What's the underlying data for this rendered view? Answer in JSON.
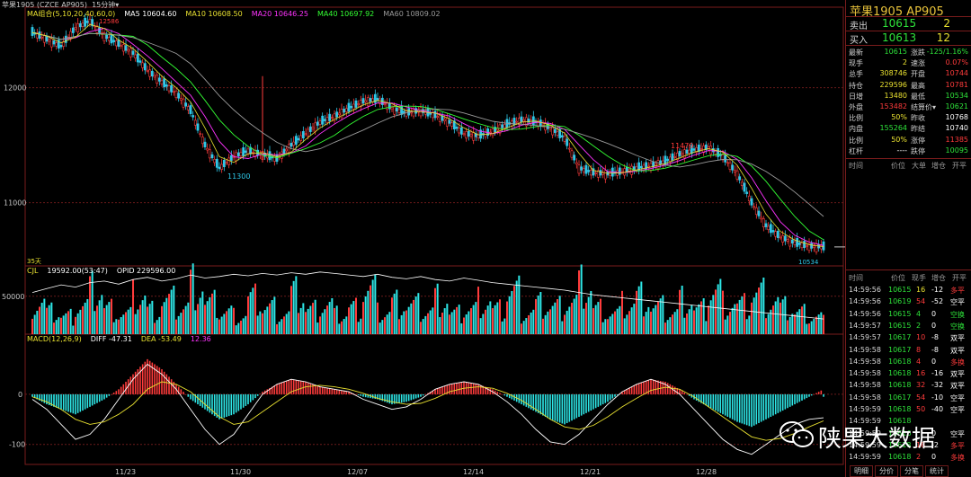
{
  "header": {
    "title": "苹果1905 (CZCE AP905)",
    "period": "15分钟",
    "ma_legend": [
      {
        "label": "MA组合(5,10,20,40,60,0)",
        "color": "#e8e030"
      },
      {
        "label": "MA5 10604.60",
        "color": "#ffffff"
      },
      {
        "label": "MA10 10608.50",
        "color": "#e8e030"
      },
      {
        "label": "MA20 10646.25",
        "color": "#ff33ff"
      },
      {
        "label": "MA40 10697.92",
        "color": "#33ff33"
      },
      {
        "label": "MA60 10809.02",
        "color": "#9a9a9a"
      }
    ],
    "vol_legend": [
      {
        "label": "CJL",
        "color": "#e8e030"
      },
      {
        "label": "19592.00(53:47)",
        "color": "#ffffff"
      },
      {
        "label": "OPID 229596.00",
        "color": "#ffffff"
      }
    ],
    "macd_legend": [
      {
        "label": "MACD(12,26,9)",
        "color": "#e8e030"
      },
      {
        "label": "DIFF -47.31",
        "color": "#ffffff"
      },
      {
        "label": "DEA -53.49",
        "color": "#e8e030"
      },
      {
        "label": "12.36",
        "color": "#ff33ff"
      }
    ]
  },
  "price_axis": {
    "labels": [
      "12000",
      "11000"
    ]
  },
  "vol_axis": {
    "labels": [
      "50000"
    ]
  },
  "macd_axis": {
    "labels": [
      "0",
      "-100"
    ]
  },
  "annotations": {
    "high_left": "12586",
    "low_mid": "11300",
    "high_right": "11479",
    "low_end": "10534",
    "bars_count": "35天"
  },
  "date_axis": [
    "11/23",
    "11/30",
    "12/07",
    "12/14",
    "12/21",
    "12/28"
  ],
  "panel": {
    "title": "苹果1905  AP905",
    "sell": {
      "label": "卖出",
      "price": "10615",
      "qty": "2"
    },
    "buy": {
      "label": "买入",
      "price": "10613",
      "qty": "12"
    },
    "stats": [
      {
        "k1": "最新",
        "v1": "10615",
        "c1": "green",
        "k2": "涨跌",
        "v2": "-125/1.16%",
        "c2": "green"
      },
      {
        "k1": "现手",
        "v1": "2",
        "c1": "yellow",
        "k2": "速涨",
        "v2": "0.07%",
        "c2": "red"
      },
      {
        "k1": "总手",
        "v1": "308746",
        "c1": "yellow",
        "k2": "开盘",
        "v2": "10744",
        "c2": "red"
      },
      {
        "k1": "持仓",
        "v1": "229596",
        "c1": "yellow",
        "k2": "最高",
        "v2": "10781",
        "c2": "red"
      },
      {
        "k1": "日增",
        "v1": "13480",
        "c1": "yellow",
        "k2": "最低",
        "v2": "10534",
        "c2": "green"
      },
      {
        "k1": "外盘",
        "v1": "153482",
        "c1": "red",
        "k2": "结算价▾",
        "v2": "10621",
        "c2": "green"
      },
      {
        "k1": "比例",
        "v1": "50%",
        "c1": "yellow",
        "k2": "昨收",
        "v2": "10768",
        "c2": "white"
      },
      {
        "k1": "内盘",
        "v1": "155264",
        "c1": "green",
        "k2": "昨结",
        "v2": "10740",
        "c2": "white"
      },
      {
        "k1": "比例",
        "v1": "50%",
        "c1": "yellow",
        "k2": "涨停",
        "v2": "11385",
        "c2": "red"
      },
      {
        "k1": "杠杆",
        "v1": "----",
        "c1": "white",
        "k2": "跌停",
        "v2": "10095",
        "c2": "green"
      }
    ],
    "trades_header_1": [
      "时间",
      "价位",
      "大单",
      "增仓",
      "开平"
    ],
    "trades_header_2": [
      "时间",
      "价位",
      "现手",
      "增仓",
      "开平"
    ],
    "trades": [
      {
        "t": "14:59:56",
        "p": "10615",
        "v": "16",
        "d": "-12",
        "o": "多平",
        "vc": "yellow",
        "oc": "red"
      },
      {
        "t": "14:59:56",
        "p": "10619",
        "v": "54",
        "d": "-52",
        "o": "空平",
        "vc": "red",
        "oc": "white"
      },
      {
        "t": "14:59:56",
        "p": "10615",
        "v": "4",
        "d": "0",
        "o": "空换",
        "vc": "green",
        "oc": "green"
      },
      {
        "t": "14:59:57",
        "p": "10615",
        "v": "2",
        "d": "0",
        "o": "空换",
        "vc": "green",
        "oc": "green"
      },
      {
        "t": "14:59:57",
        "p": "10617",
        "v": "10",
        "d": "-8",
        "o": "双平",
        "vc": "red",
        "oc": "white"
      },
      {
        "t": "14:59:58",
        "p": "10617",
        "v": "8",
        "d": "-8",
        "o": "双平",
        "vc": "red",
        "oc": "white"
      },
      {
        "t": "14:59:58",
        "p": "10618",
        "v": "4",
        "d": "0",
        "o": "多换",
        "vc": "red",
        "oc": "red"
      },
      {
        "t": "14:59:58",
        "p": "10618",
        "v": "16",
        "d": "-16",
        "o": "双平",
        "vc": "red",
        "oc": "white"
      },
      {
        "t": "14:59:58",
        "p": "10618",
        "v": "32",
        "d": "-32",
        "o": "双平",
        "vc": "red",
        "oc": "white"
      },
      {
        "t": "14:59:58",
        "p": "10617",
        "v": "54",
        "d": "-10",
        "o": "空平",
        "vc": "red",
        "oc": "white"
      },
      {
        "t": "14:59:59",
        "p": "10618",
        "v": "50",
        "d": "-40",
        "o": "空平",
        "vc": "red",
        "oc": "white"
      },
      {
        "t": "14:59:59",
        "p": "10618",
        "v": "",
        "d": "",
        "o": "",
        "vc": "red",
        "oc": "white"
      },
      {
        "t": "14:59:59",
        "p": "10616",
        "v": "",
        "d": "0",
        "o": "空平",
        "vc": "red",
        "oc": "white"
      },
      {
        "t": "14:59:59",
        "p": "10618",
        "v": "18",
        "d": "-2",
        "o": "多平",
        "vc": "red",
        "oc": "red"
      },
      {
        "t": "14:59:59",
        "p": "10618",
        "v": "2",
        "d": "0",
        "o": "多换",
        "vc": "red",
        "oc": "red"
      }
    ],
    "tabs": [
      "明细",
      "分价",
      "分笔",
      "统计"
    ]
  },
  "watermark": {
    "text": "陕果大数据",
    "icon": "wechat-icon"
  },
  "chart_data": [
    {
      "type": "candlestick",
      "title": "",
      "x": [
        "11/23",
        "11/30",
        "12/07",
        "12/14",
        "12/21",
        "12/28"
      ],
      "ylim": [
        10450,
        12700
      ],
      "close_path": [
        12480,
        12420,
        12360,
        12520,
        12580,
        12450,
        12380,
        12300,
        12150,
        12050,
        11950,
        11800,
        11500,
        11300,
        11400,
        11450,
        11420,
        11380,
        11500,
        11600,
        11700,
        11750,
        11820,
        11880,
        11900,
        11820,
        11780,
        11800,
        11760,
        11700,
        11600,
        11580,
        11620,
        11680,
        11720,
        11700,
        11650,
        11560,
        11300,
        11260,
        11250,
        11270,
        11300,
        11320,
        11360,
        11420,
        11460,
        11479,
        11400,
        11250,
        11000,
        10800,
        10700,
        10650,
        10620,
        10615
      ],
      "moving_averages": [
        {
          "name": "MA20",
          "color": "#ff33ff",
          "offset": 0
        },
        {
          "name": "MA40",
          "color": "#33ff33",
          "offset": 0
        },
        {
          "name": "MA60",
          "color": "#9a9a9a",
          "offset": 0
        }
      ],
      "labeled_points": [
        {
          "label": "12586",
          "value": 12586
        },
        {
          "label": "11300",
          "value": 11300
        },
        {
          "label": "11479",
          "value": 11479
        },
        {
          "label": "10534",
          "value": 10534
        }
      ]
    },
    {
      "type": "bar",
      "title": "",
      "ylim": [
        0,
        90000
      ],
      "volume": [
        45000,
        30000,
        25000,
        40000,
        60000,
        35000,
        28000,
        52000,
        33000,
        46000,
        38000,
        70000,
        42000,
        31000,
        26000,
        48000,
        37000,
        29000,
        55000,
        34000,
        41000,
        27000,
        36000,
        62000,
        30000,
        44000,
        39000,
        32000,
        50000,
        28000,
        35000,
        47000,
        33000,
        58000,
        31000,
        40000,
        38000,
        45000,
        66000,
        35000,
        29000,
        41000,
        52000,
        37000,
        30000,
        48000,
        34000,
        60000,
        43000,
        39000,
        56000,
        47000,
        36000,
        30000,
        25000,
        20000
      ],
      "open_interest_path": [
        55000,
        60000,
        65000,
        62000,
        68000,
        70000,
        66000,
        72000,
        75000,
        70000,
        73000,
        78000,
        74000,
        76000,
        79000,
        77000,
        80000,
        78000,
        81000,
        79000,
        82000,
        80000,
        78000,
        76000,
        79000,
        75000,
        73000,
        76000,
        72000,
        70000,
        74000,
        71000,
        68000,
        66000,
        64000,
        62000,
        60000,
        58000,
        55000,
        52000,
        50000,
        48000,
        46000,
        44000,
        42000,
        40000,
        38000,
        36000,
        34000,
        32000,
        30000,
        28000,
        26000,
        24000,
        22000,
        20000
      ]
    },
    {
      "type": "bar",
      "title": "",
      "ylim": [
        -140,
        120
      ],
      "macd_hist": [
        -5,
        -20,
        -30,
        -40,
        -25,
        -10,
        10,
        40,
        70,
        50,
        20,
        -10,
        -30,
        -50,
        -40,
        -20,
        5,
        20,
        30,
        25,
        15,
        10,
        5,
        -5,
        -10,
        -20,
        -15,
        -5,
        10,
        20,
        25,
        20,
        10,
        -5,
        -20,
        -35,
        -50,
        -60,
        -45,
        -30,
        -15,
        5,
        20,
        30,
        25,
        10,
        -10,
        -25,
        -40,
        -55,
        -65,
        -50,
        -35,
        -20,
        -5,
        10
      ],
      "diff_path": [
        -10,
        -30,
        -60,
        -90,
        -80,
        -50,
        -10,
        30,
        60,
        40,
        10,
        -30,
        -70,
        -100,
        -80,
        -40,
        0,
        20,
        30,
        25,
        15,
        10,
        5,
        -10,
        -20,
        -30,
        -25,
        -10,
        10,
        20,
        25,
        20,
        5,
        -15,
        -40,
        -70,
        -95,
        -100,
        -80,
        -50,
        -20,
        5,
        20,
        30,
        20,
        0,
        -30,
        -60,
        -90,
        -110,
        -120,
        -100,
        -80,
        -60,
        -50,
        -47
      ],
      "dea_path": [
        -5,
        -15,
        -30,
        -50,
        -60,
        -55,
        -40,
        -20,
        10,
        25,
        20,
        5,
        -20,
        -45,
        -60,
        -55,
        -35,
        -15,
        5,
        15,
        18,
        15,
        10,
        2,
        -8,
        -15,
        -20,
        -18,
        -8,
        5,
        12,
        15,
        12,
        2,
        -12,
        -30,
        -50,
        -65,
        -70,
        -62,
        -45,
        -25,
        -8,
        8,
        14,
        10,
        -5,
        -25,
        -45,
        -65,
        -85,
        -92,
        -88,
        -78,
        -65,
        -53
      ]
    }
  ]
}
